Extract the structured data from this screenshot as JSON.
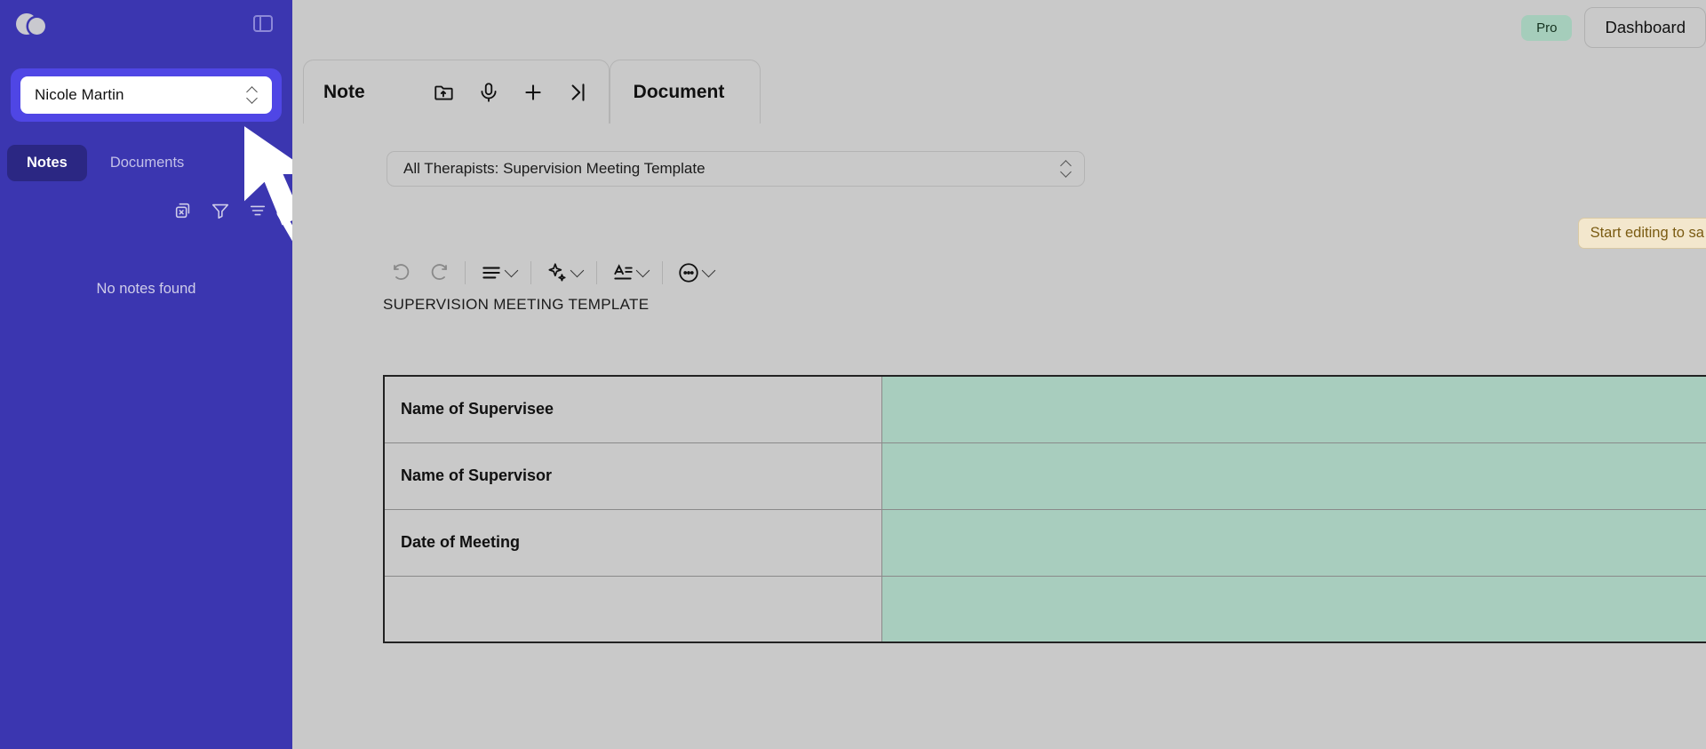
{
  "sidebar": {
    "logo_icon": "overlapping-circles-logo",
    "panel_toggle_icon": "panel-toggle-icon",
    "client_selector": {
      "value": "Nicole Martin",
      "icon": "chevron-up-down-icon"
    },
    "tabs": [
      {
        "label": "Notes",
        "active": true
      },
      {
        "label": "Documents",
        "active": false
      }
    ],
    "search_icon": "search-icon",
    "tools": [
      {
        "icon": "clear-selection-icon"
      },
      {
        "icon": "filter-funnel-icon"
      },
      {
        "icon": "sort-lines-icon"
      }
    ],
    "empty_state": "No notes found"
  },
  "header": {
    "plan_badge": "Pro",
    "dashboard_label": "Dashboard"
  },
  "tabstrip": {
    "note_tab": {
      "label": "Note",
      "icons": [
        {
          "name": "folder-upload-icon"
        },
        {
          "name": "microphone-icon"
        },
        {
          "name": "plus-icon"
        },
        {
          "name": "collapse-right-icon"
        }
      ]
    },
    "document_tab": {
      "label": "Document"
    }
  },
  "editor": {
    "template_select": {
      "value": "All Therapists: Supervision Meeting Template",
      "icon": "chevron-up-down-icon"
    },
    "save_hint": "Start editing to sa",
    "toolbar": [
      {
        "name": "undo-button",
        "icon": "undo-icon",
        "disabled": true
      },
      {
        "name": "redo-button",
        "icon": "redo-icon",
        "disabled": true
      },
      {
        "name": "align-button",
        "icon": "align-lines-icon",
        "caret": true
      },
      {
        "name": "ai-button",
        "icon": "ai-sparkle-icon",
        "caret": true
      },
      {
        "name": "text-style-button",
        "icon": "text-format-icon",
        "caret": true
      },
      {
        "name": "more-button",
        "icon": "more-dots-icon",
        "caret": true
      }
    ],
    "document_heading": "SUPERVISION MEETING TEMPLATE",
    "table": {
      "rows": [
        {
          "label": "Name of Supervisee",
          "value": ""
        },
        {
          "label": "Name of Supervisor",
          "value": ""
        },
        {
          "label": "Date of Meeting",
          "value": ""
        },
        {
          "label": "",
          "value": ""
        }
      ]
    }
  },
  "colors": {
    "sidebar_bg": "#3b36b0",
    "selector_highlight": "#4f46e5",
    "active_tab_bg": "#2b2783",
    "badge_green": "#a5cdbb",
    "table_cell_green": "#a8cdbe",
    "hint_bg": "#f3e7cd"
  }
}
